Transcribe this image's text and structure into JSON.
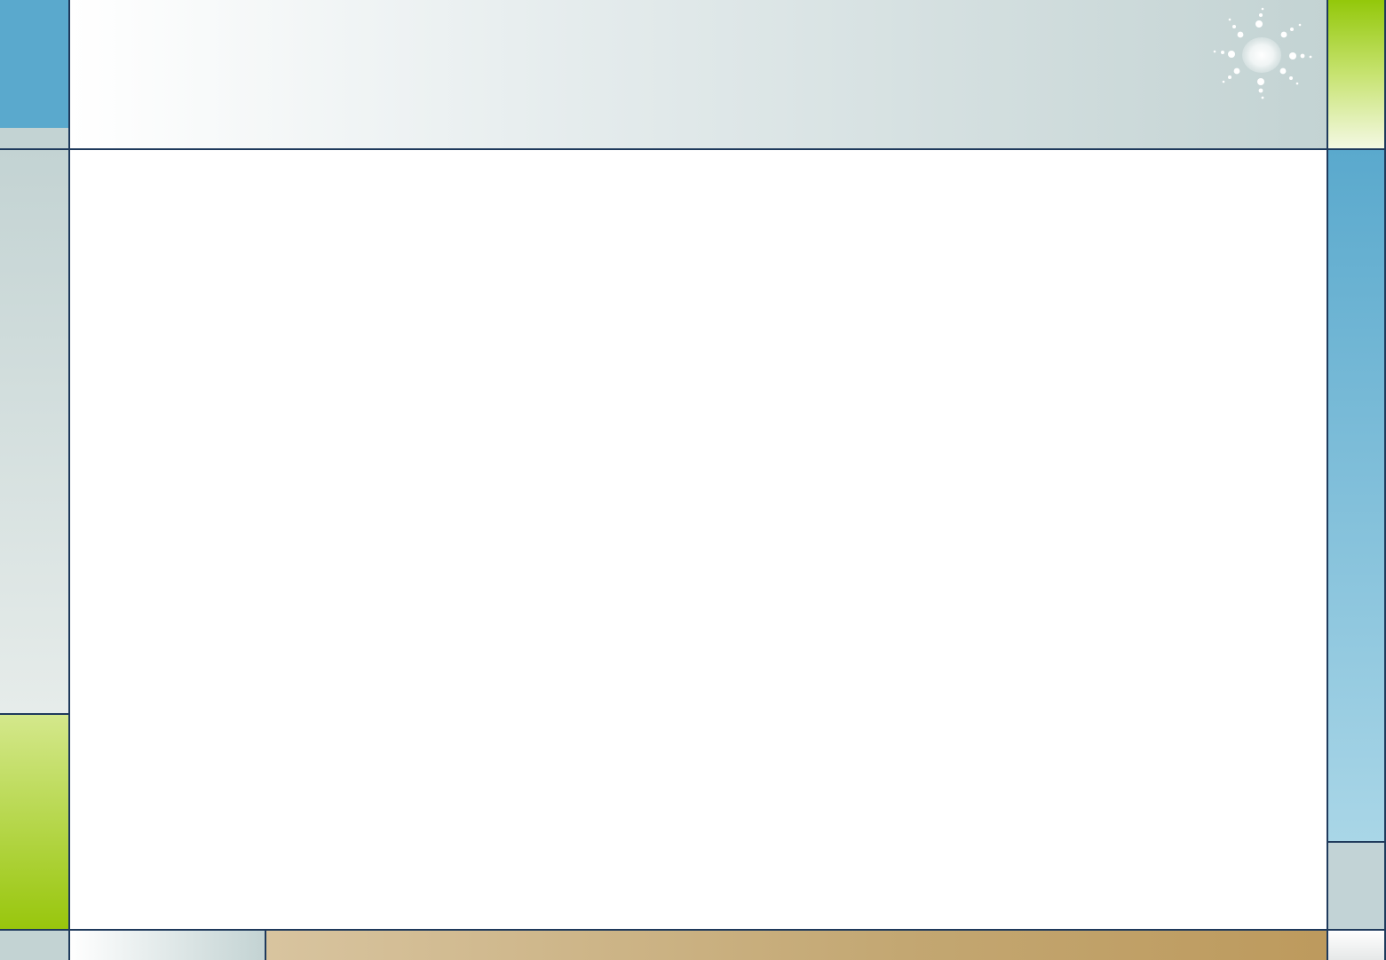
{
  "theme": {
    "accent_blue": "#5aa9cd",
    "accent_green": "#98c60c",
    "gray_blue": "#c3d3d3",
    "tan": "#c3a772",
    "border": "#1f3a5c"
  },
  "decoration": {
    "icon": "sun-icon"
  }
}
